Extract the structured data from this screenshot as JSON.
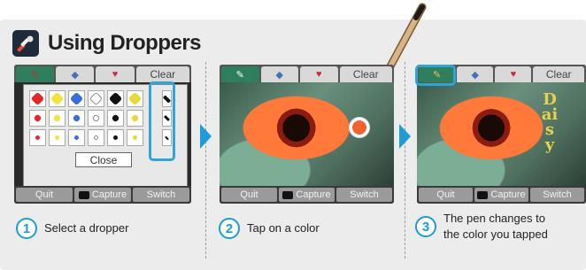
{
  "header": {
    "title": "Using Droppers"
  },
  "screens": {
    "tabs": {
      "clear_label": "Clear"
    },
    "bottom": {
      "quit": "Quit",
      "capture": "Capture",
      "switch": "Switch"
    },
    "palette_close": "Close",
    "photo_text": "Daisy"
  },
  "steps": [
    {
      "number": "1",
      "text": "Select a dropper"
    },
    {
      "number": "2",
      "text": "Tap on a color"
    },
    {
      "number": "3",
      "text_line1": "The pen changes to",
      "text_line2": "the color you tapped"
    }
  ],
  "colors": {
    "accent": "#1d9cd8",
    "panel_bg": "#ececec",
    "tap_color": "#f2622e",
    "pen_tab_active": "#2f7e5e"
  }
}
